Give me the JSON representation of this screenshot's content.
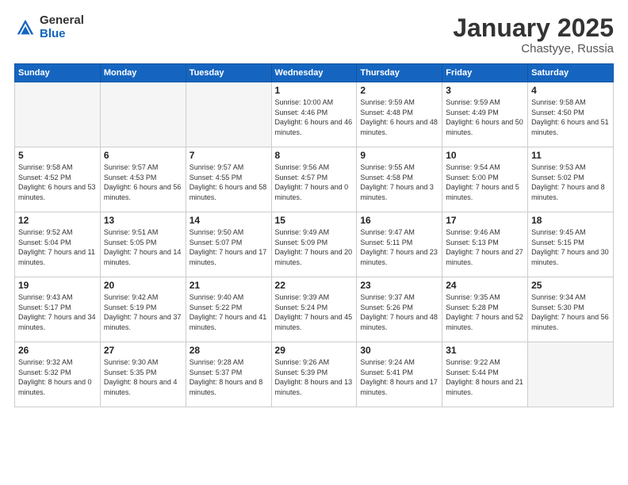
{
  "logo": {
    "general": "General",
    "blue": "Blue"
  },
  "title": "January 2025",
  "location": "Chastyye, Russia",
  "days_header": [
    "Sunday",
    "Monday",
    "Tuesday",
    "Wednesday",
    "Thursday",
    "Friday",
    "Saturday"
  ],
  "weeks": [
    [
      {
        "day": "",
        "info": ""
      },
      {
        "day": "",
        "info": ""
      },
      {
        "day": "",
        "info": ""
      },
      {
        "day": "1",
        "info": "Sunrise: 10:00 AM\nSunset: 4:46 PM\nDaylight: 6 hours and 46 minutes."
      },
      {
        "day": "2",
        "info": "Sunrise: 9:59 AM\nSunset: 4:48 PM\nDaylight: 6 hours and 48 minutes."
      },
      {
        "day": "3",
        "info": "Sunrise: 9:59 AM\nSunset: 4:49 PM\nDaylight: 6 hours and 50 minutes."
      },
      {
        "day": "4",
        "info": "Sunrise: 9:58 AM\nSunset: 4:50 PM\nDaylight: 6 hours and 51 minutes."
      }
    ],
    [
      {
        "day": "5",
        "info": "Sunrise: 9:58 AM\nSunset: 4:52 PM\nDaylight: 6 hours and 53 minutes."
      },
      {
        "day": "6",
        "info": "Sunrise: 9:57 AM\nSunset: 4:53 PM\nDaylight: 6 hours and 56 minutes."
      },
      {
        "day": "7",
        "info": "Sunrise: 9:57 AM\nSunset: 4:55 PM\nDaylight: 6 hours and 58 minutes."
      },
      {
        "day": "8",
        "info": "Sunrise: 9:56 AM\nSunset: 4:57 PM\nDaylight: 7 hours and 0 minutes."
      },
      {
        "day": "9",
        "info": "Sunrise: 9:55 AM\nSunset: 4:58 PM\nDaylight: 7 hours and 3 minutes."
      },
      {
        "day": "10",
        "info": "Sunrise: 9:54 AM\nSunset: 5:00 PM\nDaylight: 7 hours and 5 minutes."
      },
      {
        "day": "11",
        "info": "Sunrise: 9:53 AM\nSunset: 5:02 PM\nDaylight: 7 hours and 8 minutes."
      }
    ],
    [
      {
        "day": "12",
        "info": "Sunrise: 9:52 AM\nSunset: 5:04 PM\nDaylight: 7 hours and 11 minutes."
      },
      {
        "day": "13",
        "info": "Sunrise: 9:51 AM\nSunset: 5:05 PM\nDaylight: 7 hours and 14 minutes."
      },
      {
        "day": "14",
        "info": "Sunrise: 9:50 AM\nSunset: 5:07 PM\nDaylight: 7 hours and 17 minutes."
      },
      {
        "day": "15",
        "info": "Sunrise: 9:49 AM\nSunset: 5:09 PM\nDaylight: 7 hours and 20 minutes."
      },
      {
        "day": "16",
        "info": "Sunrise: 9:47 AM\nSunset: 5:11 PM\nDaylight: 7 hours and 23 minutes."
      },
      {
        "day": "17",
        "info": "Sunrise: 9:46 AM\nSunset: 5:13 PM\nDaylight: 7 hours and 27 minutes."
      },
      {
        "day": "18",
        "info": "Sunrise: 9:45 AM\nSunset: 5:15 PM\nDaylight: 7 hours and 30 minutes."
      }
    ],
    [
      {
        "day": "19",
        "info": "Sunrise: 9:43 AM\nSunset: 5:17 PM\nDaylight: 7 hours and 34 minutes."
      },
      {
        "day": "20",
        "info": "Sunrise: 9:42 AM\nSunset: 5:19 PM\nDaylight: 7 hours and 37 minutes."
      },
      {
        "day": "21",
        "info": "Sunrise: 9:40 AM\nSunset: 5:22 PM\nDaylight: 7 hours and 41 minutes."
      },
      {
        "day": "22",
        "info": "Sunrise: 9:39 AM\nSunset: 5:24 PM\nDaylight: 7 hours and 45 minutes."
      },
      {
        "day": "23",
        "info": "Sunrise: 9:37 AM\nSunset: 5:26 PM\nDaylight: 7 hours and 48 minutes."
      },
      {
        "day": "24",
        "info": "Sunrise: 9:35 AM\nSunset: 5:28 PM\nDaylight: 7 hours and 52 minutes."
      },
      {
        "day": "25",
        "info": "Sunrise: 9:34 AM\nSunset: 5:30 PM\nDaylight: 7 hours and 56 minutes."
      }
    ],
    [
      {
        "day": "26",
        "info": "Sunrise: 9:32 AM\nSunset: 5:32 PM\nDaylight: 8 hours and 0 minutes."
      },
      {
        "day": "27",
        "info": "Sunrise: 9:30 AM\nSunset: 5:35 PM\nDaylight: 8 hours and 4 minutes."
      },
      {
        "day": "28",
        "info": "Sunrise: 9:28 AM\nSunset: 5:37 PM\nDaylight: 8 hours and 8 minutes."
      },
      {
        "day": "29",
        "info": "Sunrise: 9:26 AM\nSunset: 5:39 PM\nDaylight: 8 hours and 13 minutes."
      },
      {
        "day": "30",
        "info": "Sunrise: 9:24 AM\nSunset: 5:41 PM\nDaylight: 8 hours and 17 minutes."
      },
      {
        "day": "31",
        "info": "Sunrise: 9:22 AM\nSunset: 5:44 PM\nDaylight: 8 hours and 21 minutes."
      },
      {
        "day": "",
        "info": ""
      }
    ]
  ]
}
